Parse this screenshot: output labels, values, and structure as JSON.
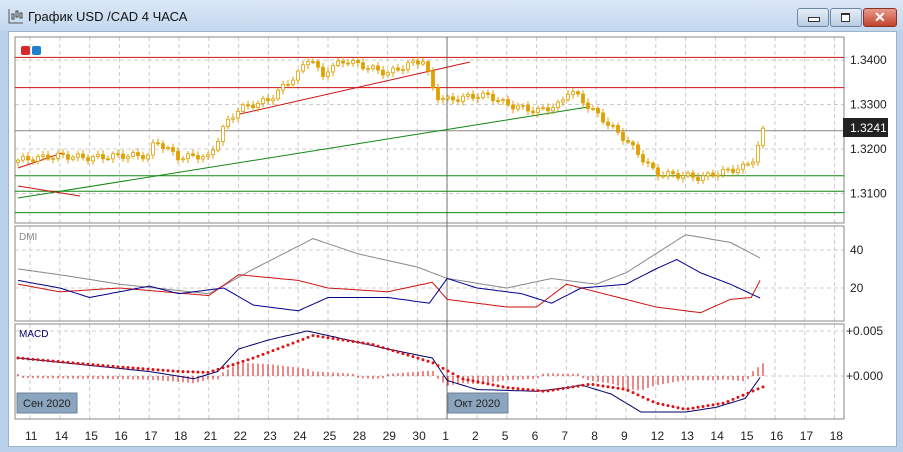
{
  "window": {
    "title": "График USD /CAD  4 ЧАСА",
    "buttons": [
      "minimize",
      "restore",
      "close"
    ]
  },
  "colors": {
    "candle": "#e0a000",
    "resistance": "#cc1111",
    "support": "#118811",
    "dmi_adx": "#888888",
    "dmi_plus": "#cc1111",
    "dmi_minus": "#00008b",
    "macd": "#00006b",
    "signal": "#dd1111",
    "price_tag_bg": "#222222"
  },
  "price_axis": {
    "ticks": [
      "1.3400",
      "1.3300",
      "1.3200",
      "1.3100"
    ],
    "current_price": "1.3241"
  },
  "dmi": {
    "label": "DMI",
    "ticks": [
      "40",
      "20"
    ]
  },
  "macd": {
    "label": "MACD",
    "ticks": [
      "+0.005",
      "+0.000"
    ]
  },
  "month_markers": [
    "Сен 2020",
    "Окт 2020"
  ],
  "x_axis": {
    "ticks": [
      "11",
      "14",
      "15",
      "16",
      "17",
      "18",
      "21",
      "22",
      "23",
      "24",
      "25",
      "28",
      "29",
      "30",
      "1",
      "2",
      "5",
      "6",
      "7",
      "8",
      "9",
      "12",
      "13",
      "14",
      "15",
      "16",
      "17",
      "18"
    ]
  },
  "chart_data": {
    "type": "line",
    "title": "USD/CAD 4H",
    "price_keypoints": [
      [
        -0.4,
        1.3175
      ],
      [
        1,
        1.3185
      ],
      [
        2,
        1.318
      ],
      [
        3,
        1.3185
      ],
      [
        4,
        1.3185
      ],
      [
        4.2,
        1.322
      ],
      [
        5,
        1.318
      ],
      [
        5.6,
        1.3185
      ],
      [
        6,
        1.318
      ],
      [
        6.5,
        1.325
      ],
      [
        7,
        1.329
      ],
      [
        8,
        1.331
      ],
      [
        9,
        1.337
      ],
      [
        9.4,
        1.341
      ],
      [
        9.8,
        1.336
      ],
      [
        10,
        1.338
      ],
      [
        10.6,
        1.34
      ],
      [
        11,
        1.339
      ],
      [
        12,
        1.337
      ],
      [
        12.7,
        1.339
      ],
      [
        13.2,
        1.34
      ],
      [
        13.6,
        1.332
      ],
      [
        14,
        1.331
      ],
      [
        15,
        1.332
      ],
      [
        15.4,
        1.332
      ],
      [
        16,
        1.33
      ],
      [
        17,
        1.3285
      ],
      [
        17.8,
        1.33
      ],
      [
        18.1,
        1.3335
      ],
      [
        18.5,
        1.331
      ],
      [
        19,
        1.328
      ],
      [
        20,
        1.322
      ],
      [
        21,
        1.3145
      ],
      [
        22,
        1.314
      ],
      [
        22.5,
        1.3135
      ],
      [
        23,
        1.3145
      ],
      [
        24,
        1.316
      ],
      [
        24.3,
        1.318
      ],
      [
        24.6,
        1.3241
      ]
    ],
    "horizontal_levels": {
      "resistance": [
        1.3406,
        1.3338
      ],
      "current": 1.3241,
      "support": [
        1.314,
        1.3105,
        1.3057
      ]
    },
    "dmi_adx": [
      [
        -0.4,
        30
      ],
      [
        1,
        27
      ],
      [
        3,
        22
      ],
      [
        6,
        17
      ],
      [
        7.5,
        30
      ],
      [
        9.5,
        46
      ],
      [
        11,
        38
      ],
      [
        13,
        31
      ],
      [
        14,
        25
      ],
      [
        16,
        20
      ],
      [
        17.5,
        25
      ],
      [
        19,
        22
      ],
      [
        20,
        28
      ],
      [
        21,
        38
      ],
      [
        22,
        48
      ],
      [
        23.5,
        44
      ],
      [
        24.6,
        35
      ]
    ],
    "dmi_plus": [
      [
        -0.4,
        22
      ],
      [
        1,
        18
      ],
      [
        3,
        20
      ],
      [
        6,
        16
      ],
      [
        7,
        27
      ],
      [
        9,
        24
      ],
      [
        10,
        20
      ],
      [
        12,
        18
      ],
      [
        13.5,
        23
      ],
      [
        14,
        14
      ],
      [
        16,
        10
      ],
      [
        17,
        10
      ],
      [
        18,
        22
      ],
      [
        19,
        18
      ],
      [
        21,
        10
      ],
      [
        22.5,
        7
      ],
      [
        23.5,
        14
      ],
      [
        24.2,
        15
      ],
      [
        24.6,
        27
      ]
    ],
    "dmi_minus": [
      [
        -0.4,
        24
      ],
      [
        1,
        20
      ],
      [
        2,
        15
      ],
      [
        4,
        21
      ],
      [
        5,
        17
      ],
      [
        6.5,
        20
      ],
      [
        7.5,
        11
      ],
      [
        9,
        8
      ],
      [
        10,
        15
      ],
      [
        12,
        15
      ],
      [
        13.4,
        12
      ],
      [
        14,
        25
      ],
      [
        15,
        20
      ],
      [
        16.5,
        17
      ],
      [
        17.5,
        12
      ],
      [
        18.5,
        20
      ],
      [
        20,
        22
      ],
      [
        21,
        30
      ],
      [
        21.7,
        35
      ],
      [
        22.5,
        28
      ],
      [
        23.5,
        22
      ],
      [
        24.6,
        14
      ]
    ],
    "macd_line": [
      [
        -0.4,
        0.002
      ],
      [
        4,
        0.0005
      ],
      [
        5.5,
        -0.0003
      ],
      [
        6.3,
        0.0005
      ],
      [
        7,
        0.003
      ],
      [
        8,
        0.004
      ],
      [
        9.3,
        0.005
      ],
      [
        10,
        0.0045
      ],
      [
        12,
        0.003
      ],
      [
        13.5,
        0.002
      ],
      [
        14,
        -0.0005
      ],
      [
        15,
        -0.0015
      ],
      [
        17,
        -0.0017
      ],
      [
        18,
        -0.0013
      ],
      [
        18.5,
        -0.001
      ],
      [
        19.5,
        -0.002
      ],
      [
        20.5,
        -0.004
      ],
      [
        22,
        -0.004
      ],
      [
        23,
        -0.0035
      ],
      [
        24,
        -0.0025
      ],
      [
        24.6,
        0.0003
      ]
    ],
    "signal_line": [
      [
        -0.4,
        0.002
      ],
      [
        3,
        0.001
      ],
      [
        5,
        0.0005
      ],
      [
        6,
        0.0004
      ],
      [
        7.5,
        0.002
      ],
      [
        9.5,
        0.0045
      ],
      [
        11.5,
        0.0035
      ],
      [
        13.5,
        0.0015
      ],
      [
        14.5,
        -0.0003
      ],
      [
        16,
        -0.0013
      ],
      [
        17.3,
        -0.0017
      ],
      [
        18.8,
        -0.0009
      ],
      [
        20,
        -0.0015
      ],
      [
        21,
        -0.003
      ],
      [
        22,
        -0.0037
      ],
      [
        23.3,
        -0.003
      ],
      [
        24.6,
        -0.0012
      ]
    ]
  }
}
